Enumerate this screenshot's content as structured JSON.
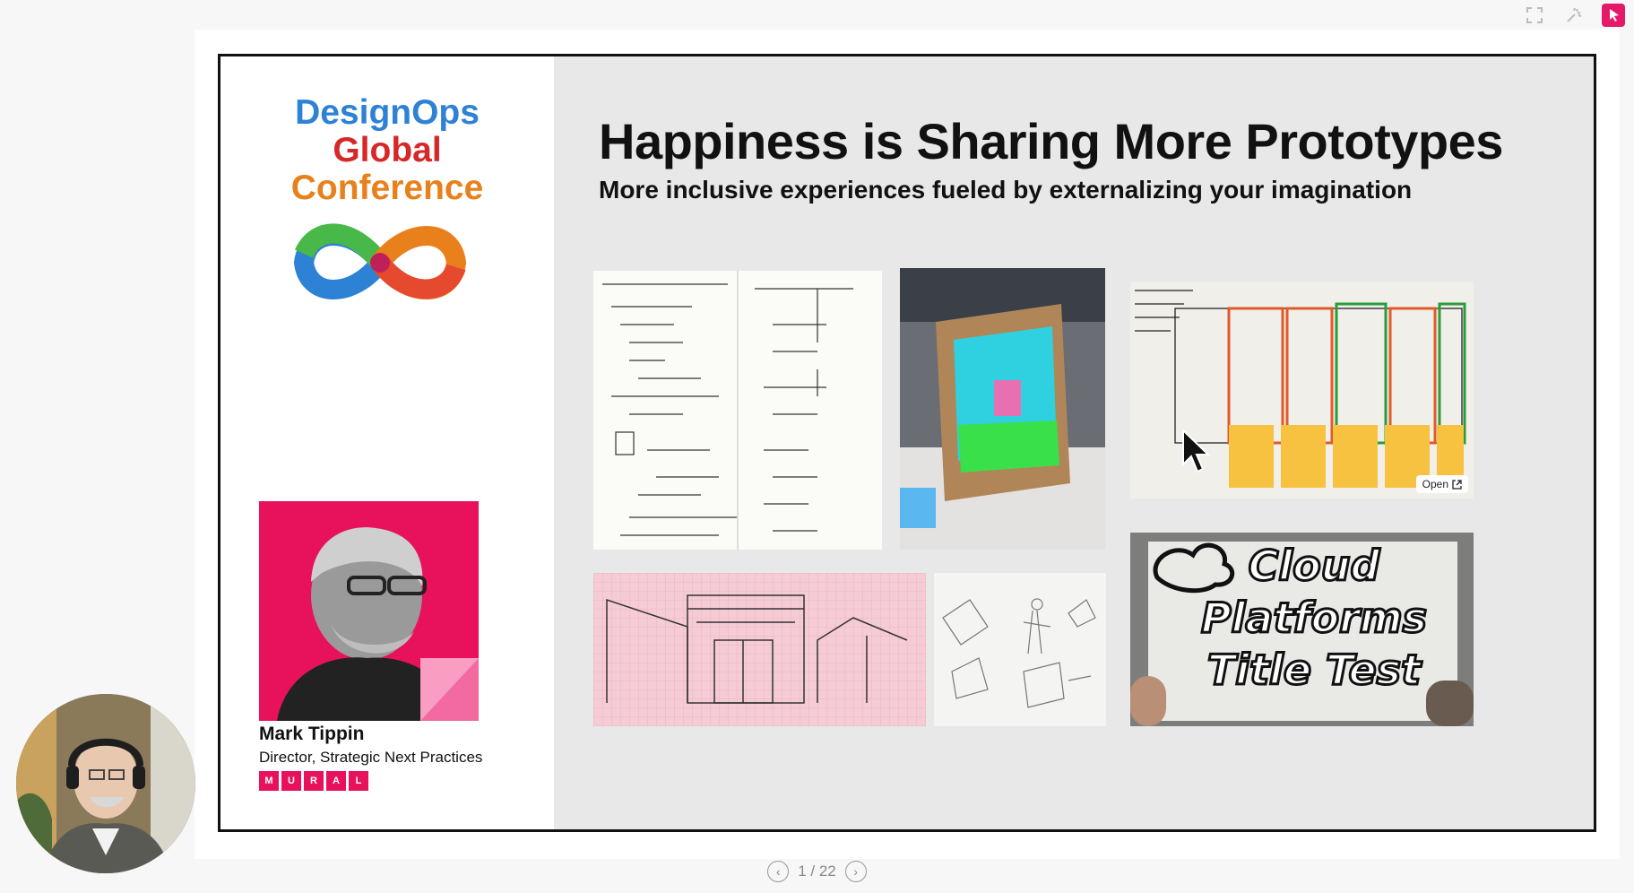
{
  "toolbar": {
    "icons": [
      "fullscreen-icon",
      "laser-pointer-icon",
      "pointer-icon"
    ],
    "accent": "#e5186a"
  },
  "slide": {
    "logo": {
      "line1": "DesignOps",
      "line2": "Global",
      "line3": "Conference"
    },
    "title": "Happiness is Sharing More Prototypes",
    "subtitle": "More inclusive experiences fueled by externalizing your imagination",
    "speaker": {
      "name": "Mark Tippin",
      "role": "Director, Strategic Next Practices",
      "company_letters": [
        "M",
        "U",
        "R",
        "A",
        "L"
      ]
    },
    "open_label": "Open",
    "cloud_text": "Cloud Platforms Title Test"
  },
  "pager": {
    "label": "1 / 22"
  },
  "colors": {
    "brand_pink": "#e8125c",
    "slide_bg": "#e8e8e8"
  }
}
